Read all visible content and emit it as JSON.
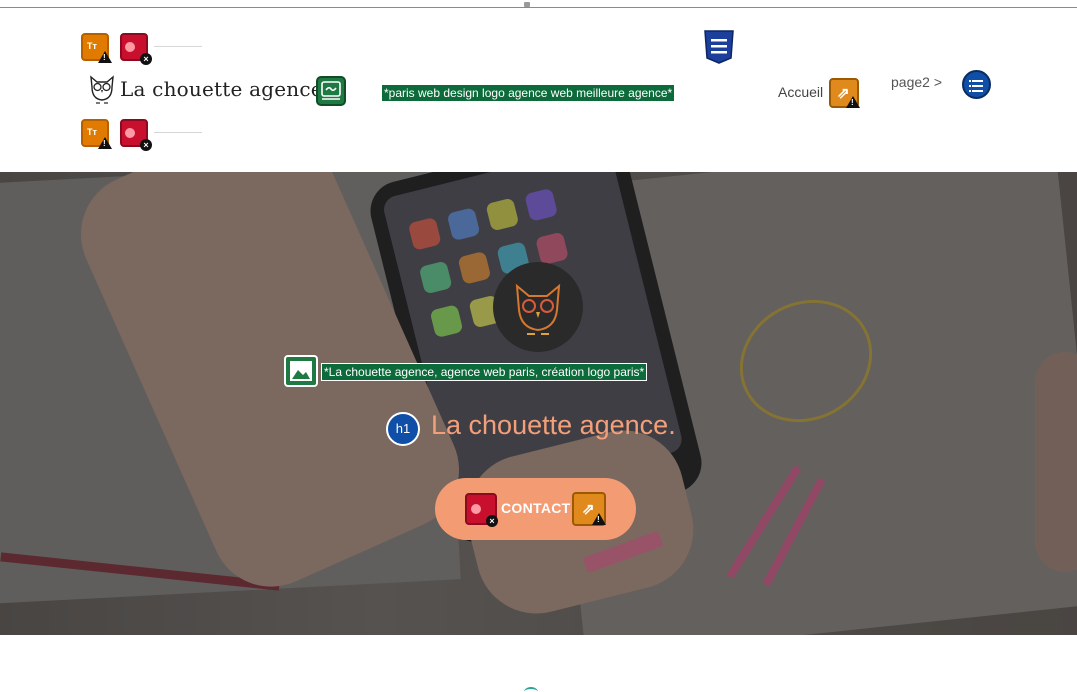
{
  "header": {
    "logo_text": "La chouette agence",
    "logo_alt_text": "*paris web design logo agence web meilleure agence*",
    "nav": [
      {
        "label": "Accueil"
      },
      {
        "label": "page2 >"
      }
    ]
  },
  "hero": {
    "image_alt_text": "*La chouette agence, agence web paris, création logo paris*",
    "heading_tag": "h1",
    "title": "La chouette agence.",
    "cta_label": "CONTACT"
  },
  "icons": {
    "font_badge": "font-size-warning-icon",
    "error_badge": "contrast-error-icon",
    "link_badge": "linked-image-icon",
    "css_badge": "css-icon",
    "external_link_badge": "external-link-warning-icon",
    "list_badge": "list-icon",
    "image_badge": "image-icon",
    "heading_badge": "heading-icon"
  },
  "colors": {
    "accent": "#f39b73",
    "alt_text_bg": "#0d6b3b",
    "heading_badge": "#0f4fa8",
    "warning_badge": "#e07b00",
    "error_badge": "#c8102e"
  }
}
